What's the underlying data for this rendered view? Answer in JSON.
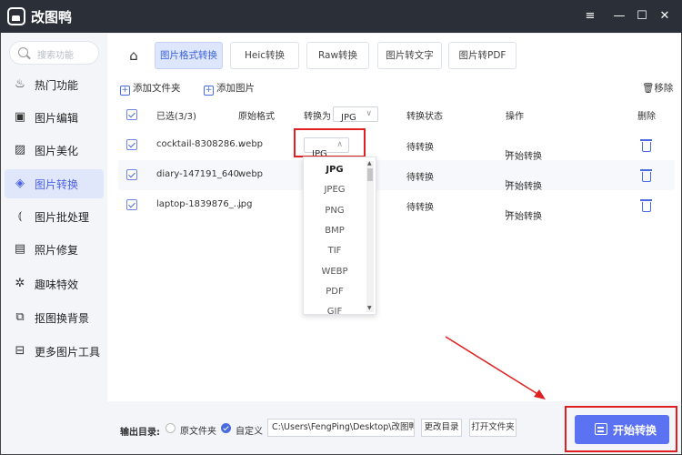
{
  "app": {
    "title": "改图鸭"
  },
  "window_controls": {
    "menu": "≡",
    "minimize": "—",
    "maximize": "☐",
    "close": "✕"
  },
  "sidebar": {
    "search_placeholder": "搜索功能",
    "items": [
      {
        "label": "热门功能",
        "icon": "fire-icon",
        "glyph": "♨"
      },
      {
        "label": "图片编辑",
        "icon": "image-edit-icon",
        "glyph": "▣"
      },
      {
        "label": "图片美化",
        "icon": "image-beautify-icon",
        "glyph": "▨"
      },
      {
        "label": "图片转换",
        "icon": "image-convert-icon",
        "glyph": "◈",
        "active": true
      },
      {
        "label": "图片批处理",
        "icon": "batch-icon",
        "glyph": "⦅"
      },
      {
        "label": "照片修复",
        "icon": "photo-repair-icon",
        "glyph": "▤"
      },
      {
        "label": "趣味特效",
        "icon": "sparkle-icon",
        "glyph": "✲"
      },
      {
        "label": "抠图换背景",
        "icon": "cutout-icon",
        "glyph": "⧉"
      },
      {
        "label": "更多图片工具",
        "icon": "toolbox-icon",
        "glyph": "⊟"
      }
    ]
  },
  "tabs": [
    "图片格式转换",
    "Heic转换",
    "Raw转换",
    "图片转文字",
    "图片转PDF"
  ],
  "toolbar": {
    "add_folder": "添加文件夹",
    "add_image": "添加图片",
    "remove": "移除"
  },
  "table": {
    "headers": {
      "selected": "已选(3/3)",
      "original_format": "原始格式",
      "convert_to": "转换为",
      "convert_to_value": "JPG",
      "status": "转换状态",
      "action": "操作",
      "delete": "删除"
    },
    "rows": [
      {
        "name": "cocktail-8308286...",
        "format": "webp",
        "target": "JPG",
        "status": "待转换",
        "action": "开始转换"
      },
      {
        "name": "diary-147191_640",
        "format": "webp",
        "target": "",
        "status": "待转换",
        "action": "开始转换"
      },
      {
        "name": "laptop-1839876_...",
        "format": "jpg",
        "target": "",
        "status": "待转换",
        "action": "开始转换"
      }
    ]
  },
  "dropdown": {
    "options": [
      "JPG",
      "JPEG",
      "PNG",
      "BMP",
      "TIF",
      "WEBP",
      "PDF",
      "GIF"
    ],
    "selected": "JPG"
  },
  "bottom": {
    "output_label": "输出目录:",
    "option_original": "原文件夹",
    "option_custom": "自定义",
    "path": "C:\\Users\\FengPing\\Desktop\\改图鸭",
    "change_dir": "更改目录",
    "open_folder": "打开文件夹",
    "start": "开始转换"
  },
  "colors": {
    "accent": "#4a6be0",
    "button": "#5b72f2",
    "annotation": "#e02020",
    "titlebar": "#2b2f38"
  }
}
